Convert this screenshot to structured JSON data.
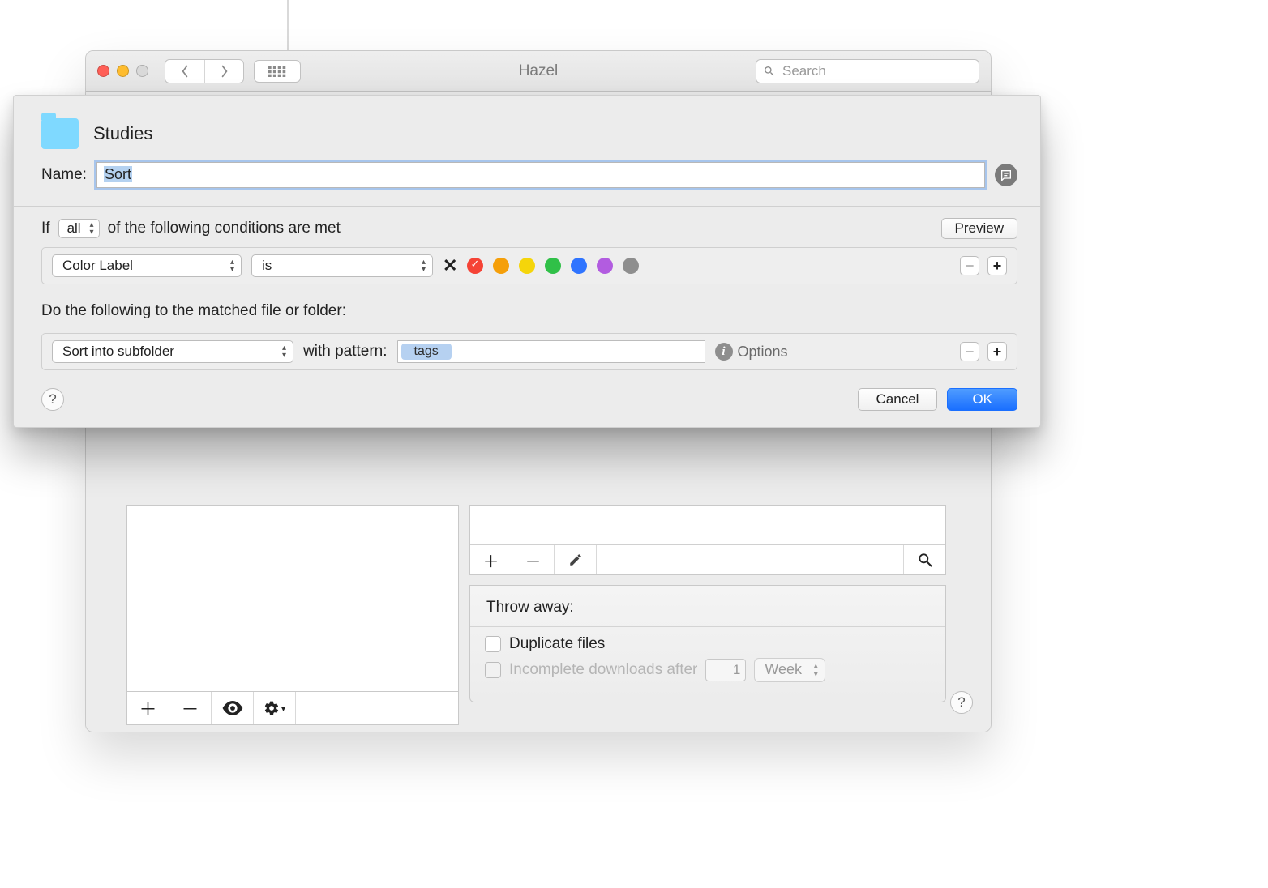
{
  "window": {
    "title": "Hazel",
    "search_placeholder": "Search"
  },
  "sheet": {
    "folder_name": "Studies",
    "name_label": "Name:",
    "name_value": "Sort",
    "if_prefix": "If",
    "if_scope": "all",
    "if_suffix": "of the following conditions are met",
    "preview": "Preview",
    "condition": {
      "attribute": "Color Label",
      "operator": "is"
    },
    "do_label": "Do the following to the matched file or folder:",
    "action": {
      "verb": "Sort into subfolder",
      "pattern_label": "with pattern:",
      "token": "tags",
      "options": "Options"
    },
    "cancel": "Cancel",
    "ok": "OK"
  },
  "throw": {
    "heading": "Throw away:",
    "duplicate": "Duplicate files",
    "incomplete": "Incomplete downloads after",
    "incomplete_value": "1",
    "incomplete_unit": "Week"
  }
}
